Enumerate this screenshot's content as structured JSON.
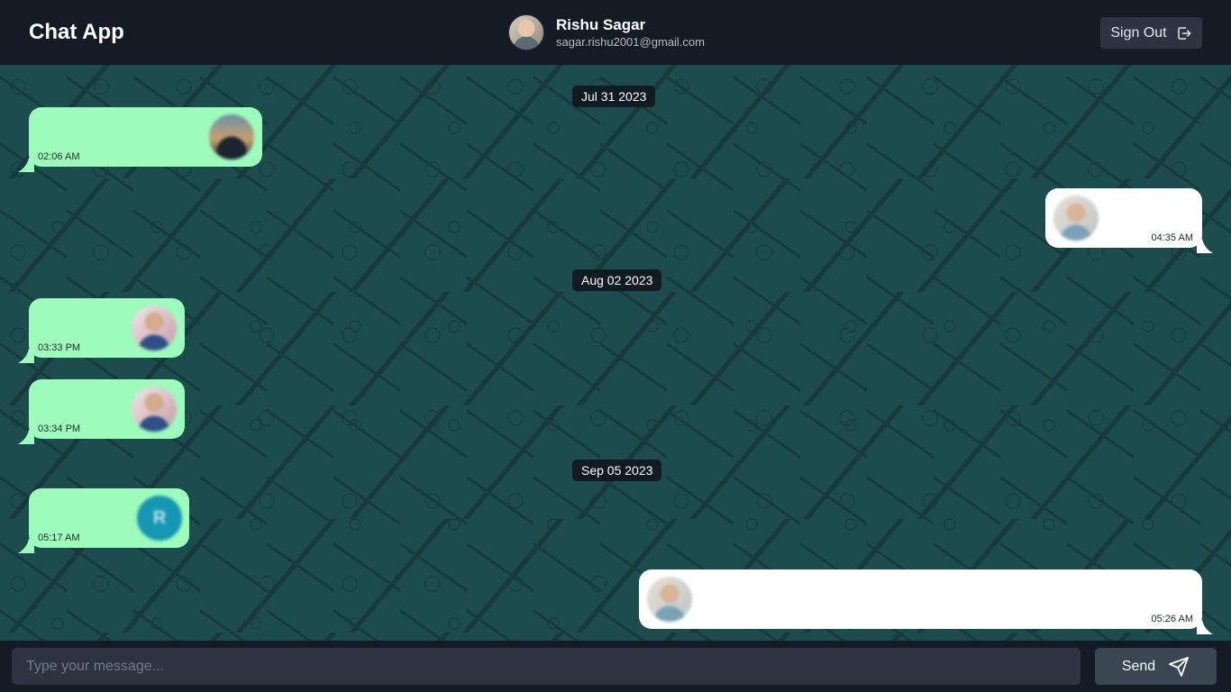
{
  "header": {
    "app_title": "Chat App",
    "user": {
      "name": "Rishu Sagar",
      "email": "sagar.rishu2001@gmail.com"
    },
    "signout_label": "Sign Out"
  },
  "chat": {
    "dates": [
      "Jul 31 2023",
      "Aug 02 2023",
      "Sep 05 2023"
    ],
    "messages": [
      {
        "direction": "incoming",
        "time": "02:06 AM",
        "image": "landscape-photo"
      },
      {
        "direction": "outgoing",
        "time": "04:35 AM",
        "image": "person-photo"
      },
      {
        "direction": "incoming",
        "time": "03:33 PM",
        "image": "person-photo"
      },
      {
        "direction": "incoming",
        "time": "03:34 PM",
        "image": "person-photo"
      },
      {
        "direction": "incoming",
        "time": "05:17 AM",
        "image": "avatar-letter",
        "letter": "R"
      },
      {
        "direction": "outgoing",
        "time": "05:26 AM",
        "image": "person-photo"
      }
    ]
  },
  "composer": {
    "placeholder": "Type your message...",
    "value": "",
    "send_label": "Send"
  },
  "colors": {
    "header_bg": "#141b24",
    "chat_bg": "#1d4c4e",
    "incoming_bubble": "#9dfcbb",
    "outgoing_bubble": "#ffffff",
    "date_pill": "#131b22",
    "button_bg": "#2b3440"
  }
}
